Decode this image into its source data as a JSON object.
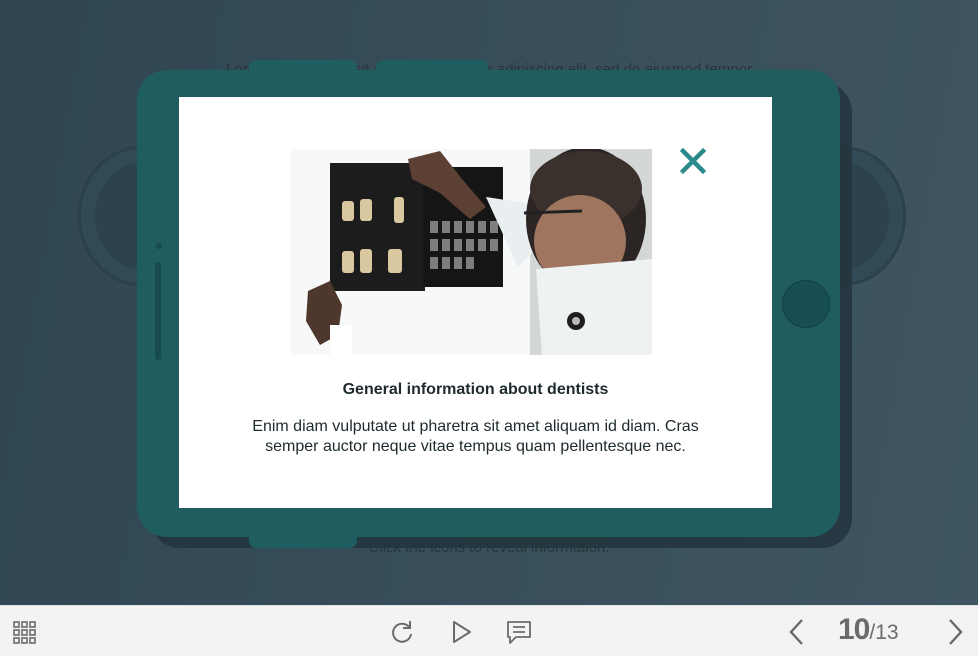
{
  "background": {
    "intro_text": "Lorem ipsum dolor sit amet, consectetur adipiscing elit, sed do eiusmod tempor",
    "hint_text": "Click the icons to reveal information."
  },
  "popup": {
    "title": "General information about dentists",
    "body": "Enim diam vulputate ut pharetra sit amet aliquam id diam. Cras semper auctor neque vitae tempus quam pellentesque nec.",
    "close_icon": "close-icon",
    "image_subject": "dentist examining dental x-ray film"
  },
  "toolbar": {
    "menu_icon": "grid-menu-icon",
    "replay_icon": "replay-icon",
    "play_icon": "play-icon",
    "notes_icon": "notes-icon",
    "prev_icon": "chevron-left-icon",
    "next_icon": "chevron-right-icon",
    "current_page": "10",
    "total_pages": "/13"
  },
  "colors": {
    "accent": "#2a8a8c",
    "tablet": "#1f5d60",
    "overlay": "#2f4652",
    "toolbar_bg": "#f3f3f3",
    "toolbar_icon": "#6b6b6b"
  }
}
